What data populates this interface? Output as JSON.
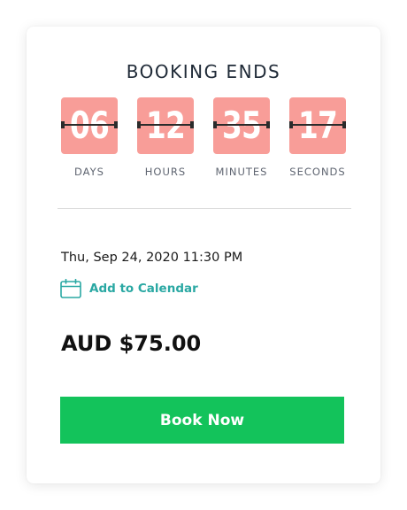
{
  "widget": {
    "title": "BOOKING ENDS",
    "countdown": [
      {
        "value": "06",
        "label": "DAYS"
      },
      {
        "value": "12",
        "label": "HOURS"
      },
      {
        "value": "35",
        "label": "MINUTES"
      },
      {
        "value": "17",
        "label": "SECONDS"
      }
    ],
    "date_text": "Thu, Sep 24, 2020 11:30 PM",
    "add_calendar_label": "Add to Calendar",
    "add_calendar_icon": "calendar-icon",
    "price": "AUD $75.00",
    "book_button_label": "Book Now"
  },
  "colors": {
    "flip_card": "#f89d98",
    "accent_teal": "#2aa8a3",
    "button_green": "#13c35b"
  }
}
